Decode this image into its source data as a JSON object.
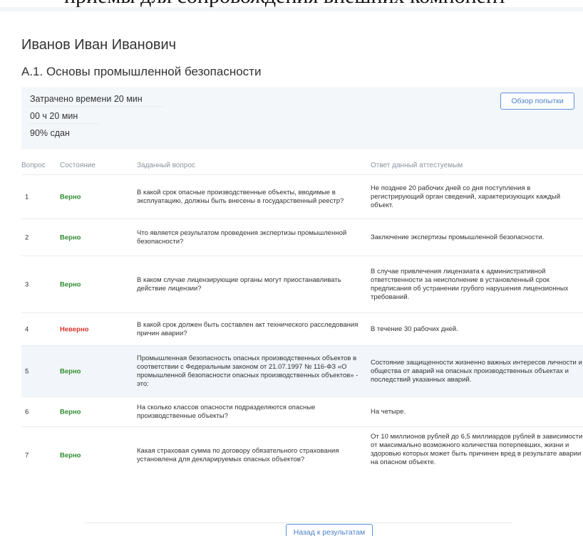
{
  "top_fragment": "приемы для сопровождения внешних компонент",
  "person_name": "Иванов Иван Иванович",
  "test_title": "А.1. Основы промышленной безопасности",
  "summary": {
    "time_spent": "Затрачено времени 20 мин",
    "duration": "00 ч 20 мин",
    "result": "90% сдан",
    "review_button": "Обзор попытки"
  },
  "table": {
    "headers": {
      "num": "Вопрос",
      "state": "Состояние",
      "question": "Заданный вопрос",
      "answer": "Ответ данный аттестуемым"
    },
    "rows": [
      {
        "num": "1",
        "state": "Верно",
        "question": "В какой срок опасные производственные объекты, вводимые в эксплуатацию, должны быть внесены в государственный реестр?",
        "answer": "Не позднее 20 рабочих дней со дня поступления в регистрирующий орган сведений, характеризующих каждый объект."
      },
      {
        "num": "2",
        "state": "Верно",
        "question": "Что является результатом проведения экспертизы промышленной безопасности?",
        "answer": "Заключение экспертизы промышленной безопасности."
      },
      {
        "num": "3",
        "state": "Верно",
        "question": "В каком случае лицензирующие органы могут приостанавливать действие лицензии?",
        "answer": "В случае привлечения лицензиата к административной ответственности за неисполнение в установленный срок предписания об устранении грубого нарушения лицензионных требований."
      },
      {
        "num": "4",
        "state": "Неверно",
        "question": "В какой срок должен быть составлен акт технического расследования причин аварии?",
        "answer": "В течение 30 рабочих дней."
      },
      {
        "num": "5",
        "state": "Верно",
        "question": "Промышленная безопасность опасных производственных объектов в соответствии с Федеральным законом от 21.07.1997 № 116-ФЗ «О промышленной безопасности опасных производственных объектов» - это:",
        "answer": "Состояние защищенности жизненно важных интересов личности и общества от аварий на опасных производственных объектах и последствий указанных аварий."
      },
      {
        "num": "6",
        "state": "Верно",
        "question": "На сколько классов опасности подразделяются опасные производственные объекты?",
        "answer": "На четыре."
      },
      {
        "num": "7",
        "state": "Верно",
        "question": "Какая страховая сумма по договору обязательного страхования установлена для декларируемых опасных объектов?",
        "answer": "От 10 миллионов рублей до 6,5 миллиардов рублей в зависимости от максимально возможного количества потерпевших, жизни и здоровью которых может быть причинен вред в результате аварии на опасном объекте."
      }
    ]
  },
  "back_button": "Назад к результатам",
  "colors": {
    "correct": "#2f8a2f",
    "incorrect": "#d9322b",
    "accent": "#4a7fc8"
  }
}
